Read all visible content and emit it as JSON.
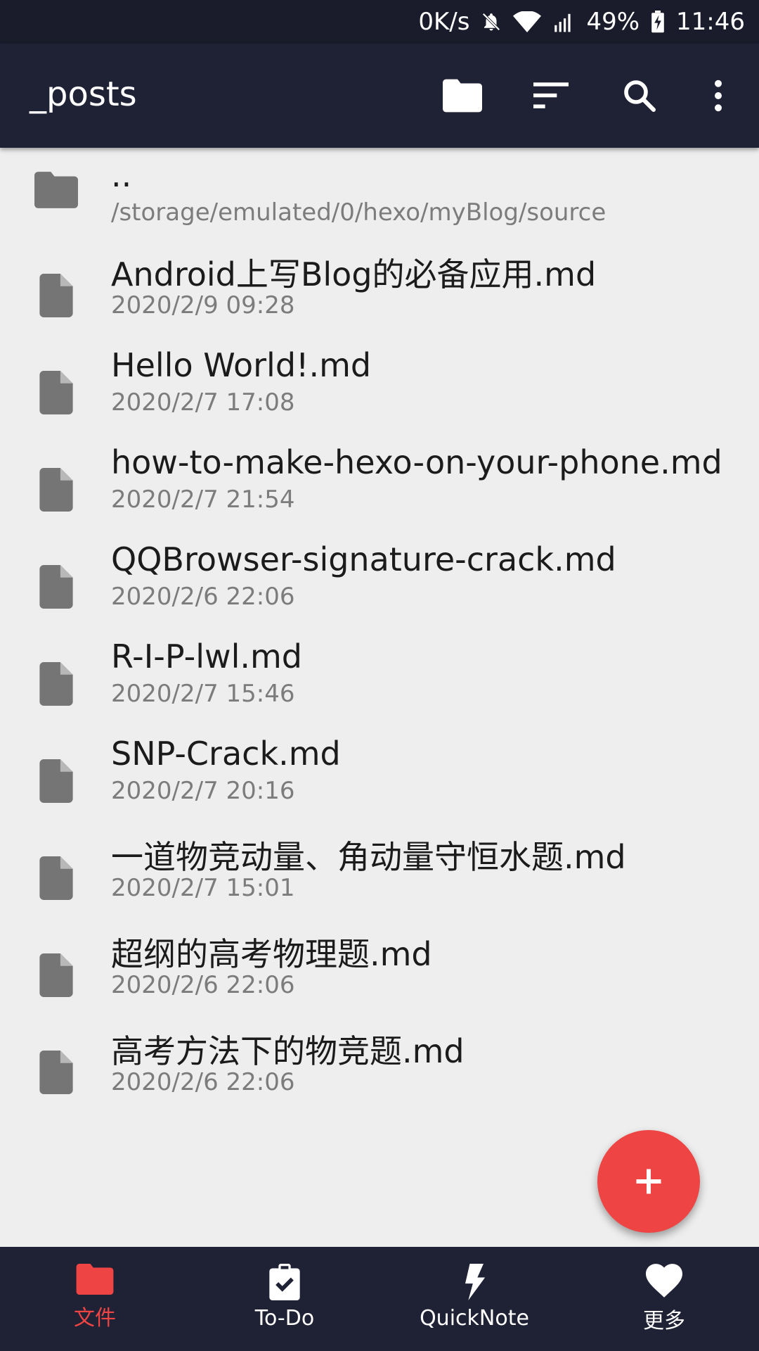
{
  "status_bar": {
    "net_speed": "0K/s",
    "battery": "49%",
    "time": "11:46",
    "icons": [
      "mute-bell-icon",
      "wifi-icon",
      "signal-icon",
      "battery-charging-icon"
    ]
  },
  "app_bar": {
    "title": "_posts",
    "actions": [
      "folder-icon",
      "sort-icon",
      "search-icon",
      "more-vert-icon"
    ]
  },
  "parent_dir": {
    "name": "..",
    "path": "/storage/emulated/0/hexo/myBlog/source"
  },
  "files": [
    {
      "name": "Android上写Blog的必备应用.md",
      "date": "2020/2/9 09:28"
    },
    {
      "name": "Hello World!.md",
      "date": "2020/2/7 17:08"
    },
    {
      "name": "how-to-make-hexo-on-your-phone.md",
      "date": "2020/2/7 21:54"
    },
    {
      "name": "QQBrowser-signature-crack.md",
      "date": "2020/2/6 22:06"
    },
    {
      "name": "R-I-P-lwl.md",
      "date": "2020/2/7 15:46"
    },
    {
      "name": "SNP-Crack.md",
      "date": "2020/2/7 20:16"
    },
    {
      "name": "一道物竞动量、角动量守恒水题.md",
      "date": "2020/2/7 15:01"
    },
    {
      "name": "超纲的高考物理题.md",
      "date": "2020/2/6 22:06"
    },
    {
      "name": "高考方法下的物竞题.md",
      "date": "2020/2/6 22:06"
    }
  ],
  "fab": {
    "icon": "plus-icon"
  },
  "bottom_nav": {
    "tabs": [
      {
        "label": "文件",
        "icon": "folder-icon"
      },
      {
        "label": "To-Do",
        "icon": "clipboard-check-icon"
      },
      {
        "label": "QuickNote",
        "icon": "lightning-icon"
      },
      {
        "label": "更多",
        "icon": "heart-icon"
      }
    ]
  },
  "colors": {
    "accent": "#ee4444",
    "bar": "#1f2235",
    "background": "#eeeeee"
  }
}
